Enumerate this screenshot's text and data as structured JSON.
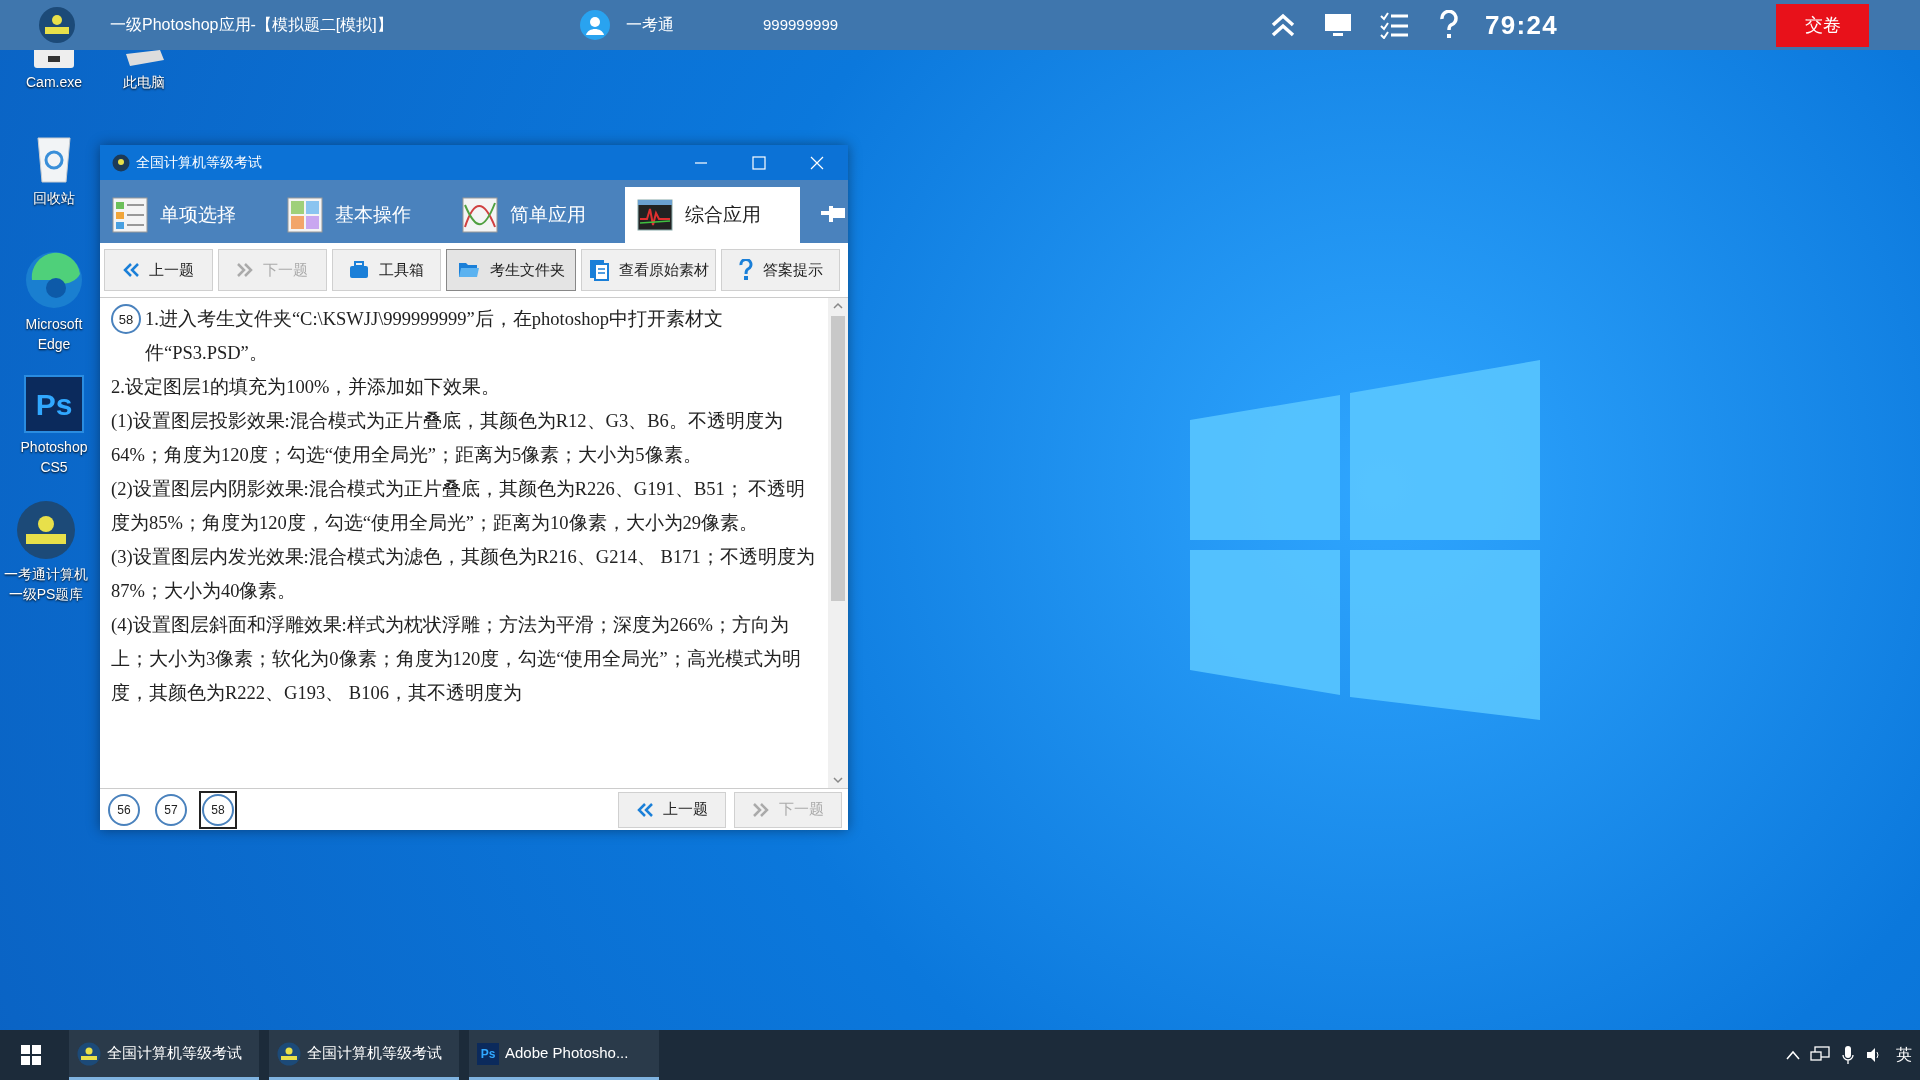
{
  "exam_bar": {
    "title": "一级Photoshop应用-【模拟题二[模拟]】",
    "user": "一考通",
    "user_id": "999999999",
    "timer": "79:24",
    "submit": "交卷"
  },
  "desktop_icons": [
    {
      "label": "Cam.exe",
      "kind": "app"
    },
    {
      "label": "此电脑",
      "kind": "pc"
    },
    {
      "label": "回收站",
      "kind": "recycle"
    },
    {
      "label": "Microsoft Edge",
      "kind": "edge"
    },
    {
      "label": "Photoshop CS5",
      "kind": "photoshop",
      "glyph": "Ps"
    },
    {
      "label": "一考通计算机一级PS题库",
      "kind": "exam"
    }
  ],
  "window": {
    "title": "全国计算机等级考试",
    "tabs": [
      {
        "label": "单项选择",
        "kind": "list",
        "selected": false
      },
      {
        "label": "基本操作",
        "kind": "grid",
        "selected": false
      },
      {
        "label": "简单应用",
        "kind": "curve",
        "selected": false
      },
      {
        "label": "综合应用",
        "kind": "monitor",
        "selected": true
      }
    ],
    "toolbar": [
      {
        "label": "上一题",
        "kind": "prev",
        "disabled": false,
        "pressed": false
      },
      {
        "label": "下一题",
        "kind": "next",
        "disabled": true,
        "pressed": false
      },
      {
        "label": "工具箱",
        "kind": "toolbox",
        "disabled": false,
        "pressed": false
      },
      {
        "label": "考生文件夹",
        "kind": "folder",
        "disabled": false,
        "pressed": true
      },
      {
        "label": "查看原始素材",
        "kind": "document",
        "disabled": false,
        "pressed": false
      },
      {
        "label": "答案提示",
        "kind": "help",
        "disabled": false,
        "pressed": false
      }
    ],
    "question_number": "58",
    "paragraphs": [
      "1.进入考生文件夹“C:\\KSWJJ\\999999999”后，在photoshop中打开素材文件“PS3.PSD”。",
      "2.设定图层1的填充为100%，并添加如下效果。",
      "(1)设置图层投影效果:混合模式为正片叠底，其颜色为R12、G3、B6。不透明度为64%；角度为120度；勾选“使用全局光”；距离为5像素；大小为5像素。",
      "(2)设置图层内阴影效果:混合模式为正片叠底，其颜色为R226、G191、B51； 不透明度为85%；角度为120度，勾选“使用全局光”；距离为10像素，大小为29像素。",
      "(3)设置图层内发光效果:混合模式为滤色，其颜色为R216、G214、 B171；不透明度为87%；大小为40像素。",
      "(4)设置图层斜面和浮雕效果:样式为枕状浮雕；方法为平滑；深度为266%；方向为上；大小为3像素；软化为0像素；角度为120度，勾选“使用全局光”；高光模式为明度，其颜色为R222、G193、 B106，其不透明度为"
    ],
    "question_nav": [
      {
        "label": "56",
        "selected": false
      },
      {
        "label": "57",
        "selected": false
      },
      {
        "label": "58",
        "selected": true
      }
    ],
    "bottom_buttons": [
      {
        "label": "上一题",
        "kind": "prev",
        "disabled": false
      },
      {
        "label": "下一题",
        "kind": "next",
        "disabled": true
      }
    ]
  },
  "taskbar": {
    "items": [
      {
        "label": "全国计算机等级考试",
        "kind": "exam"
      },
      {
        "label": "全国计算机等级考试",
        "kind": "exam"
      },
      {
        "label": "Adobe Photosho...",
        "kind": "photoshop",
        "glyph": "Ps"
      }
    ],
    "ime": "英"
  }
}
